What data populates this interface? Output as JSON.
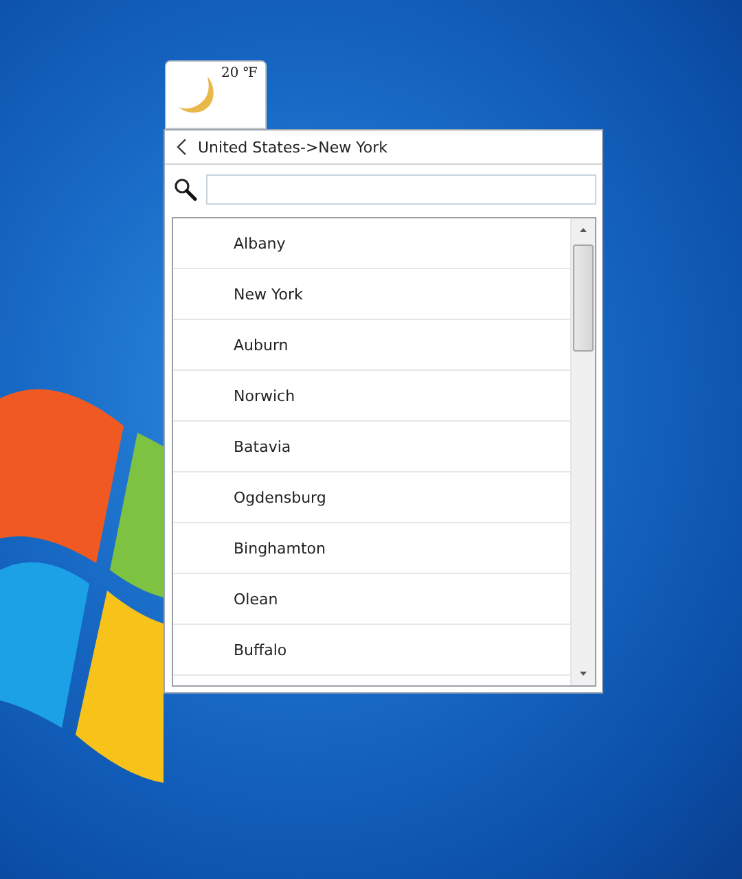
{
  "weather_gadget": {
    "temperature": "20 ℉"
  },
  "location_panel": {
    "breadcrumb": "United States->New York",
    "cities": [
      {
        "name": "Albany"
      },
      {
        "name": "New York"
      },
      {
        "name": "Auburn"
      },
      {
        "name": "Norwich"
      },
      {
        "name": "Batavia"
      },
      {
        "name": "Ogdensburg"
      },
      {
        "name": "Binghamton"
      },
      {
        "name": "Olean"
      },
      {
        "name": "Buffalo"
      }
    ]
  }
}
